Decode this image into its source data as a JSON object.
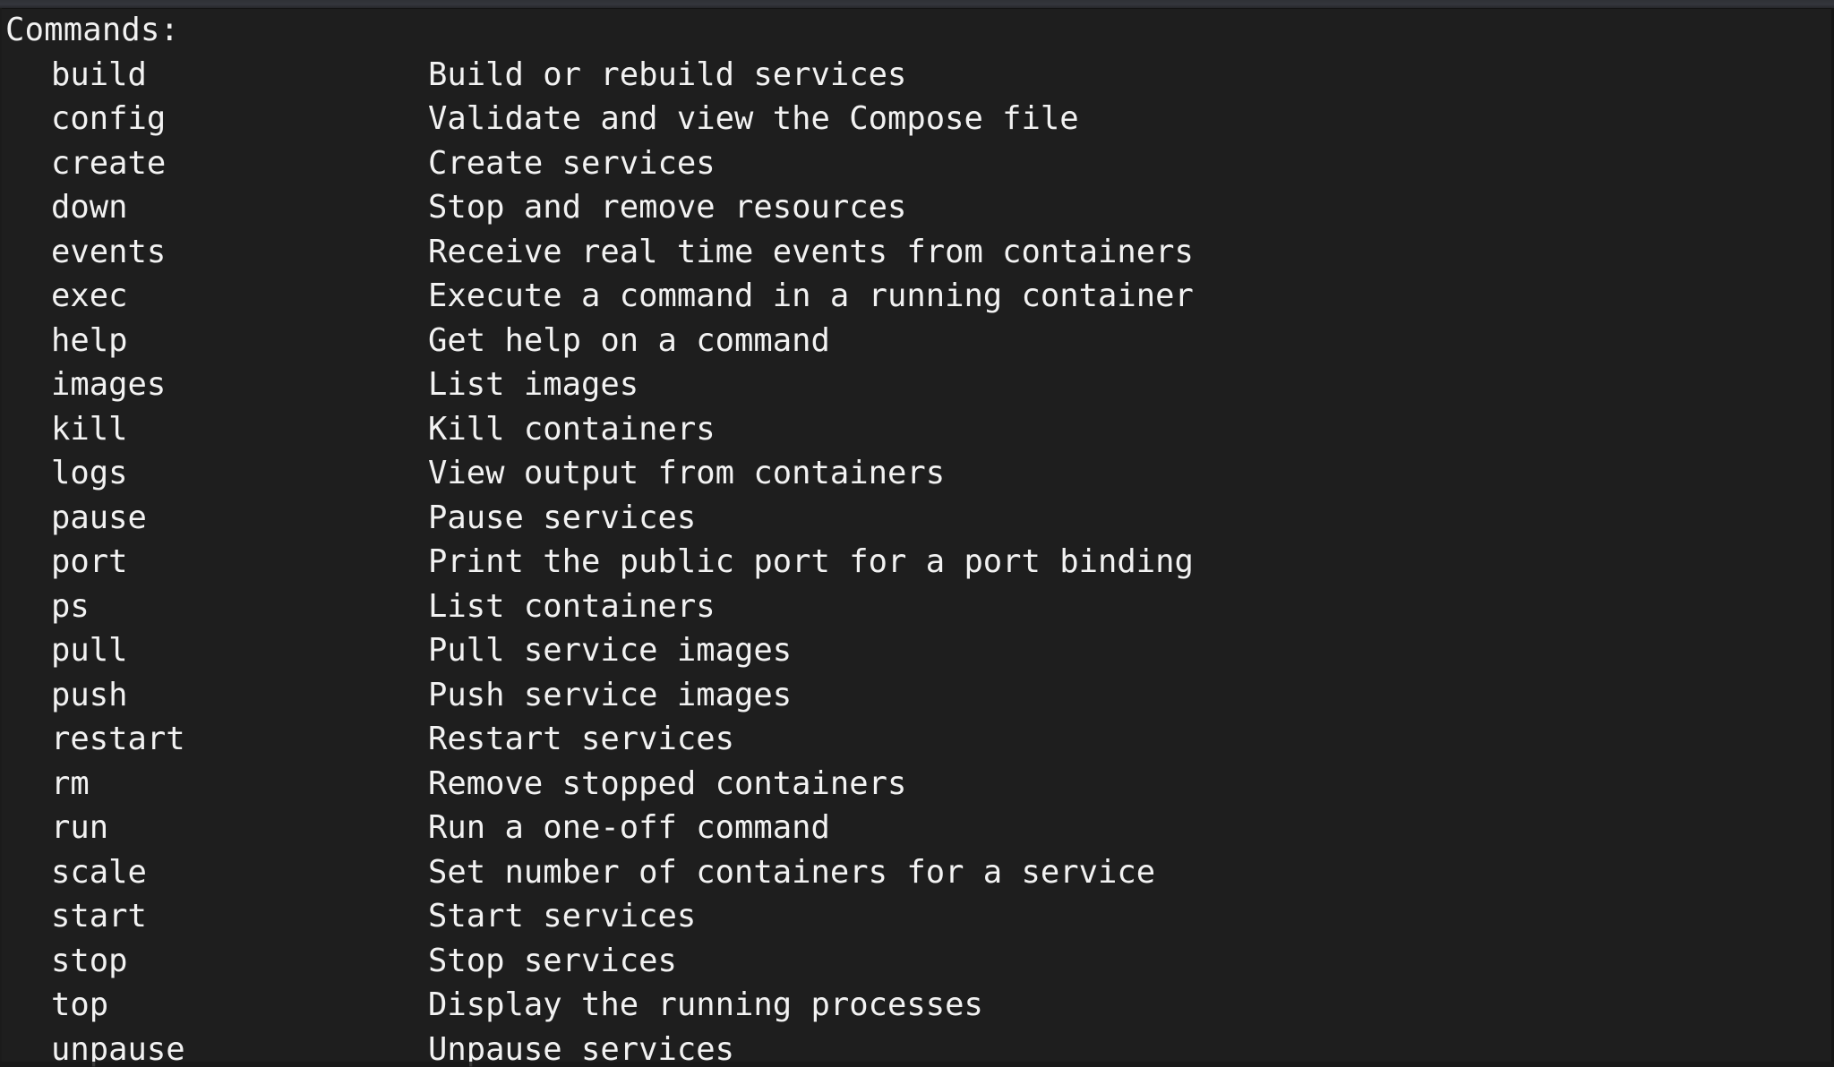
{
  "terminal": {
    "heading": "Commands:",
    "background_color": "#1e1e1e",
    "foreground_color": "#f2f2f2",
    "commands": [
      {
        "name": "build",
        "description": "Build or rebuild services"
      },
      {
        "name": "config",
        "description": "Validate and view the Compose file"
      },
      {
        "name": "create",
        "description": "Create services"
      },
      {
        "name": "down",
        "description": "Stop and remove resources"
      },
      {
        "name": "events",
        "description": "Receive real time events from containers"
      },
      {
        "name": "exec",
        "description": "Execute a command in a running container"
      },
      {
        "name": "help",
        "description": "Get help on a command"
      },
      {
        "name": "images",
        "description": "List images"
      },
      {
        "name": "kill",
        "description": "Kill containers"
      },
      {
        "name": "logs",
        "description": "View output from containers"
      },
      {
        "name": "pause",
        "description": "Pause services"
      },
      {
        "name": "port",
        "description": "Print the public port for a port binding"
      },
      {
        "name": "ps",
        "description": "List containers"
      },
      {
        "name": "pull",
        "description": "Pull service images"
      },
      {
        "name": "push",
        "description": "Push service images"
      },
      {
        "name": "restart",
        "description": "Restart services"
      },
      {
        "name": "rm",
        "description": "Remove stopped containers"
      },
      {
        "name": "run",
        "description": "Run a one-off command"
      },
      {
        "name": "scale",
        "description": "Set number of containers for a service"
      },
      {
        "name": "start",
        "description": "Start services"
      },
      {
        "name": "stop",
        "description": "Stop services"
      },
      {
        "name": "top",
        "description": "Display the running processes"
      },
      {
        "name": "unpause",
        "description": "Unpause services"
      }
    ]
  }
}
